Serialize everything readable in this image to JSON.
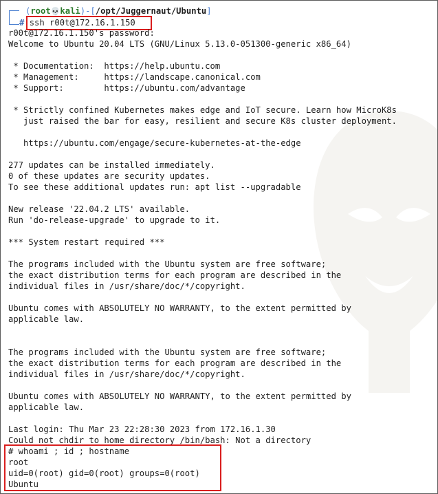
{
  "prompt": {
    "user": "root",
    "skull_icon": "skull-icon",
    "host": "kali",
    "path": "/opt/Juggernaut/Ubuntu",
    "command": "ssh r00t@172.16.1.150"
  },
  "output_lines": [
    "r00t@172.16.1.150's password:",
    "Welcome to Ubuntu 20.04 LTS (GNU/Linux 5.13.0-051300-generic x86_64)",
    "",
    " * Documentation:  https://help.ubuntu.com",
    " * Management:     https://landscape.canonical.com",
    " * Support:        https://ubuntu.com/advantage",
    "",
    " * Strictly confined Kubernetes makes edge and IoT secure. Learn how MicroK8s",
    "   just raised the bar for easy, resilient and secure K8s cluster deployment.",
    "",
    "   https://ubuntu.com/engage/secure-kubernetes-at-the-edge",
    "",
    "277 updates can be installed immediately.",
    "0 of these updates are security updates.",
    "To see these additional updates run: apt list --upgradable",
    "",
    "New release '22.04.2 LTS' available.",
    "Run 'do-release-upgrade' to upgrade to it.",
    "",
    "*** System restart required ***",
    "",
    "The programs included with the Ubuntu system are free software;",
    "the exact distribution terms for each program are described in the",
    "individual files in /usr/share/doc/*/copyright.",
    "",
    "Ubuntu comes with ABSOLUTELY NO WARRANTY, to the extent permitted by",
    "applicable law.",
    "",
    "",
    "The programs included with the Ubuntu system are free software;",
    "the exact distribution terms for each program are described in the",
    "individual files in /usr/share/doc/*/copyright.",
    "",
    "Ubuntu comes with ABSOLUTELY NO WARRANTY, to the extent permitted by",
    "applicable law.",
    "",
    "Last login: Thu Mar 23 22:28:30 2023 from 172.16.1.30",
    "Could not chdir to home directory /bin/bash: Not a directory",
    "# whoami ; id ; hostname",
    "root",
    "uid=0(root) gid=0(root) groups=0(root)",
    "Ubuntu"
  ],
  "colors": {
    "highlight_box": "#d91d1d",
    "prompt_accent": "#4a7fd0",
    "prompt_user": "#2b7a2b"
  }
}
